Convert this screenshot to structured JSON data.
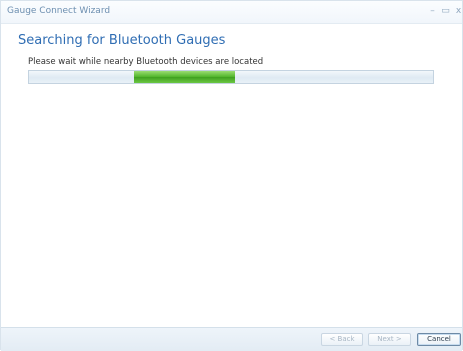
{
  "window": {
    "title": "Gauge Connect Wizard",
    "controls": {
      "minimize": "–",
      "maximize": "▭",
      "close": "x"
    }
  },
  "page": {
    "heading": "Searching for Bluetooth Gauges",
    "instruction": "Please wait while nearby Bluetooth devices are located"
  },
  "progress": {
    "mode": "indeterminate",
    "chunk_start_fraction": 0.26,
    "chunk_width_fraction": 0.25,
    "track_color": "#e3edf5",
    "chunk_color": "#4fb52a"
  },
  "buttons": {
    "back": "< Back",
    "next": "Next >",
    "cancel": "Cancel"
  }
}
